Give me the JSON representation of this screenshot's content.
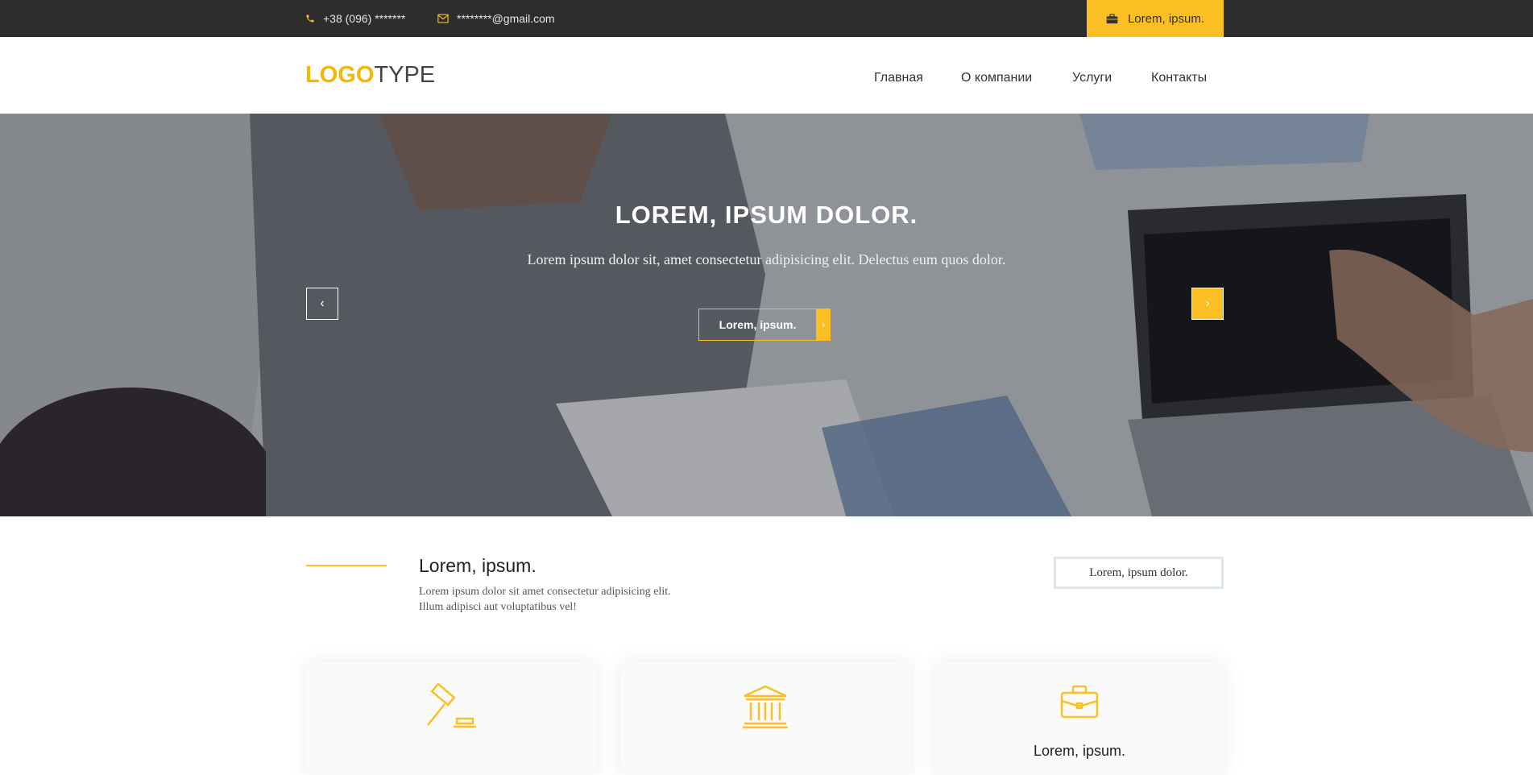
{
  "topbar": {
    "phone": "+38 (096) *******",
    "email": "********@gmail.com",
    "cta_label": "Lorem, ipsum."
  },
  "header": {
    "logo_highlight": "LOGO",
    "logo_rest": "TYPE",
    "nav": [
      "Главная",
      "О компании",
      "Услуги",
      "Контакты"
    ]
  },
  "hero": {
    "title": "LOREM, IPSUM DOLOR.",
    "subtitle": "Lorem ipsum dolor sit, amet consectetur adipisicing elit. Delectus eum quos dolor.",
    "button_label": "Lorem, ipsum.",
    "prev_glyph": "‹",
    "next_glyph": "›",
    "button_arrow": "›"
  },
  "about": {
    "title": "Lorem, ipsum.",
    "text_line1": "Lorem ipsum dolor sit amet consectetur adipisicing elit.",
    "text_line2": "Illum adipisci aut voluptatibus vel!",
    "button_label": "Lorem, ipsum dolor."
  },
  "cards": [
    {
      "icon": "gavel-icon",
      "label": ""
    },
    {
      "icon": "bank-icon",
      "label": ""
    },
    {
      "icon": "briefcase-icon",
      "label": "Lorem, ipsum."
    }
  ],
  "colors": {
    "accent": "#fbbf23",
    "topbar_bg": "#2d2d2d"
  }
}
